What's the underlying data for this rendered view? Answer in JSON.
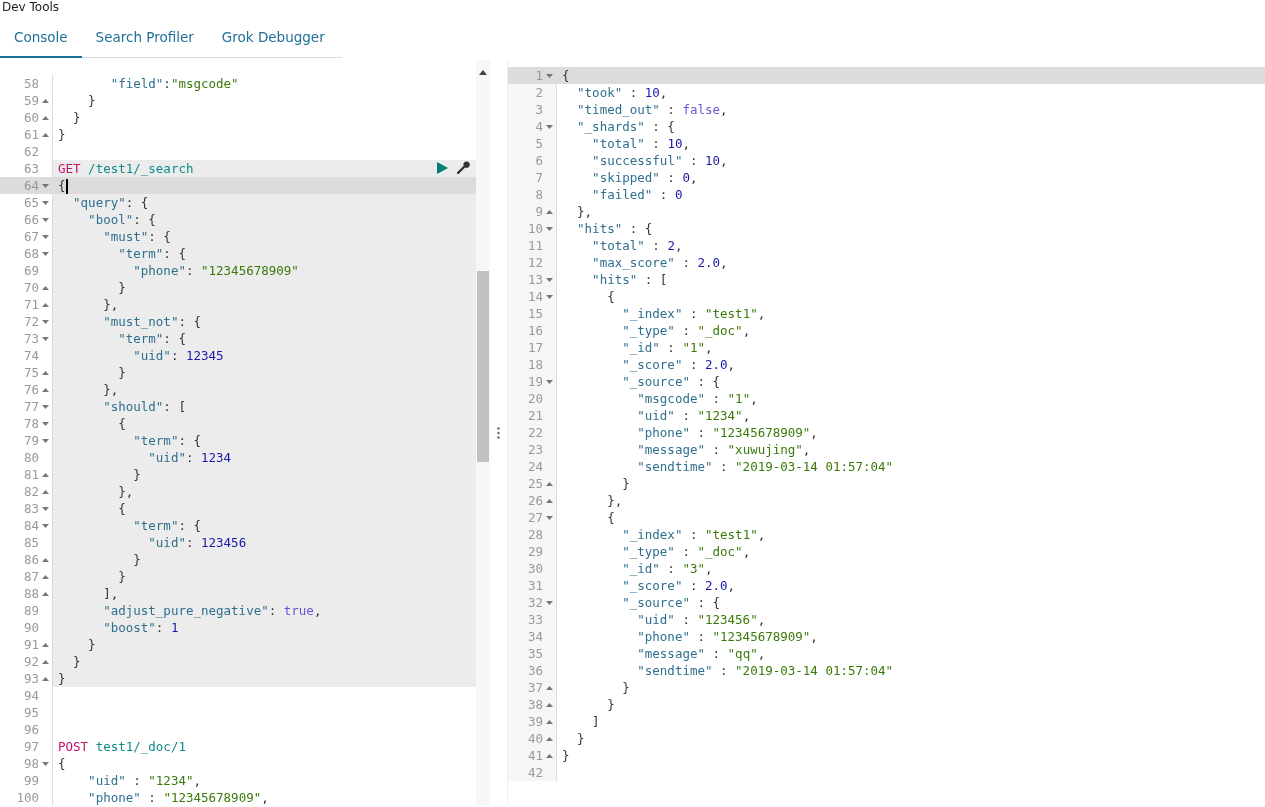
{
  "app_title": "Dev Tools",
  "tabs": [
    {
      "label": "Console",
      "selected": true
    },
    {
      "label": "Search Profiler",
      "selected": false
    },
    {
      "label": "Grok Debugger",
      "selected": false
    }
  ],
  "request_editor": {
    "lines": [
      {
        "n": "58",
        "highlighted": false,
        "active": false,
        "tokens": [
          {
            "kind": "key",
            "text": "       \"field\""
          },
          {
            "kind": "punct",
            "text": ":"
          },
          {
            "kind": "string",
            "text": "\"msgcode\""
          }
        ]
      },
      {
        "n": "59",
        "fold_start": false,
        "highlighted": false,
        "active": false,
        "tokens": [
          {
            "kind": "punct",
            "text": "    }"
          }
        ]
      },
      {
        "n": "60",
        "fold_start": false,
        "highlighted": false,
        "active": false,
        "tokens": [
          {
            "kind": "punct",
            "text": "  }"
          }
        ]
      },
      {
        "n": "61",
        "fold_start": false,
        "highlighted": false,
        "active": false,
        "tokens": [
          {
            "kind": "punct",
            "text": "}"
          }
        ]
      },
      {
        "n": "62",
        "highlighted": false,
        "active": false
      },
      {
        "n": "63",
        "highlighted": true,
        "active": false,
        "actions": true,
        "tokens": [
          {
            "kind": "method",
            "text": "GET"
          },
          {
            "kind": "url",
            "text": " /test1/_search"
          }
        ]
      },
      {
        "n": "64",
        "fold_start": true,
        "highlighted": true,
        "active": true,
        "tokens": [
          {
            "kind": "punct",
            "text": "{"
          }
        ]
      },
      {
        "n": "65",
        "fold_start": true,
        "highlighted": true,
        "active": false,
        "tokens": [
          {
            "kind": "key",
            "text": "  \"query\""
          },
          {
            "kind": "punct",
            "text": ": {"
          }
        ]
      },
      {
        "n": "66",
        "fold_start": true,
        "highlighted": true,
        "active": false,
        "tokens": [
          {
            "kind": "key",
            "text": "    \"bool\""
          },
          {
            "kind": "punct",
            "text": ": {"
          }
        ]
      },
      {
        "n": "67",
        "fold_start": true,
        "highlighted": true,
        "active": false,
        "tokens": [
          {
            "kind": "key",
            "text": "      \"must\""
          },
          {
            "kind": "punct",
            "text": ": {"
          }
        ]
      },
      {
        "n": "68",
        "fold_start": true,
        "highlighted": true,
        "active": false,
        "tokens": [
          {
            "kind": "key",
            "text": "        \"term\""
          },
          {
            "kind": "punct",
            "text": ": {"
          }
        ]
      },
      {
        "n": "69",
        "highlighted": true,
        "active": false,
        "tokens": [
          {
            "kind": "key",
            "text": "          \"phone\""
          },
          {
            "kind": "punct",
            "text": ": "
          },
          {
            "kind": "string",
            "text": "\"12345678909\""
          }
        ]
      },
      {
        "n": "70",
        "fold_start": false,
        "highlighted": true,
        "active": false,
        "tokens": [
          {
            "kind": "punct",
            "text": "        }"
          }
        ]
      },
      {
        "n": "71",
        "fold_start": false,
        "highlighted": true,
        "active": false,
        "tokens": [
          {
            "kind": "punct",
            "text": "      },"
          }
        ]
      },
      {
        "n": "72",
        "fold_start": true,
        "highlighted": true,
        "active": false,
        "tokens": [
          {
            "kind": "key",
            "text": "      \"must_not\""
          },
          {
            "kind": "punct",
            "text": ": {"
          }
        ]
      },
      {
        "n": "73",
        "fold_start": true,
        "highlighted": true,
        "active": false,
        "tokens": [
          {
            "kind": "key",
            "text": "        \"term\""
          },
          {
            "kind": "punct",
            "text": ": {"
          }
        ]
      },
      {
        "n": "74",
        "highlighted": true,
        "active": false,
        "tokens": [
          {
            "kind": "key",
            "text": "          \"uid\""
          },
          {
            "kind": "punct",
            "text": ": "
          },
          {
            "kind": "number",
            "text": "12345"
          }
        ]
      },
      {
        "n": "75",
        "fold_start": false,
        "highlighted": true,
        "active": false,
        "tokens": [
          {
            "kind": "punct",
            "text": "        }"
          }
        ]
      },
      {
        "n": "76",
        "fold_start": false,
        "highlighted": true,
        "active": false,
        "tokens": [
          {
            "kind": "punct",
            "text": "      },"
          }
        ]
      },
      {
        "n": "77",
        "fold_start": true,
        "highlighted": true,
        "active": false,
        "tokens": [
          {
            "kind": "key",
            "text": "      \"should\""
          },
          {
            "kind": "punct",
            "text": ": ["
          }
        ]
      },
      {
        "n": "78",
        "fold_start": true,
        "highlighted": true,
        "active": false,
        "tokens": [
          {
            "kind": "punct",
            "text": "        {"
          }
        ]
      },
      {
        "n": "79",
        "fold_start": true,
        "highlighted": true,
        "active": false,
        "tokens": [
          {
            "kind": "key",
            "text": "          \"term\""
          },
          {
            "kind": "punct",
            "text": ": {"
          }
        ]
      },
      {
        "n": "80",
        "highlighted": true,
        "active": false,
        "tokens": [
          {
            "kind": "key",
            "text": "            \"uid\""
          },
          {
            "kind": "punct",
            "text": ": "
          },
          {
            "kind": "number",
            "text": "1234"
          }
        ]
      },
      {
        "n": "81",
        "fold_start": false,
        "highlighted": true,
        "active": false,
        "tokens": [
          {
            "kind": "punct",
            "text": "          }"
          }
        ]
      },
      {
        "n": "82",
        "fold_start": false,
        "highlighted": true,
        "active": false,
        "tokens": [
          {
            "kind": "punct",
            "text": "        },"
          }
        ]
      },
      {
        "n": "83",
        "fold_start": true,
        "highlighted": true,
        "active": false,
        "tokens": [
          {
            "kind": "punct",
            "text": "        {"
          }
        ]
      },
      {
        "n": "84",
        "fold_start": true,
        "highlighted": true,
        "active": false,
        "tokens": [
          {
            "kind": "key",
            "text": "          \"term\""
          },
          {
            "kind": "punct",
            "text": ": {"
          }
        ]
      },
      {
        "n": "85",
        "highlighted": true,
        "active": false,
        "tokens": [
          {
            "kind": "key",
            "text": "            \"uid\""
          },
          {
            "kind": "punct",
            "text": ": "
          },
          {
            "kind": "number",
            "text": "123456"
          }
        ]
      },
      {
        "n": "86",
        "fold_start": false,
        "highlighted": true,
        "active": false,
        "tokens": [
          {
            "kind": "punct",
            "text": "          }"
          }
        ]
      },
      {
        "n": "87",
        "fold_start": false,
        "highlighted": true,
        "active": false,
        "tokens": [
          {
            "kind": "punct",
            "text": "        }"
          }
        ]
      },
      {
        "n": "88",
        "fold_start": false,
        "highlighted": true,
        "active": false,
        "tokens": [
          {
            "kind": "punct",
            "text": "      ],"
          }
        ]
      },
      {
        "n": "89",
        "highlighted": true,
        "active": false,
        "tokens": [
          {
            "kind": "key",
            "text": "      \"adjust_pure_negative\""
          },
          {
            "kind": "punct",
            "text": ": "
          },
          {
            "kind": "bool",
            "text": "true"
          },
          {
            "kind": "punct",
            "text": ","
          }
        ]
      },
      {
        "n": "90",
        "highlighted": true,
        "active": false,
        "tokens": [
          {
            "kind": "key",
            "text": "      \"boost\""
          },
          {
            "kind": "punct",
            "text": ": "
          },
          {
            "kind": "number",
            "text": "1"
          }
        ]
      },
      {
        "n": "91",
        "fold_start": false,
        "highlighted": true,
        "active": false,
        "tokens": [
          {
            "kind": "punct",
            "text": "    }"
          }
        ]
      },
      {
        "n": "92",
        "fold_start": false,
        "highlighted": true,
        "active": false,
        "tokens": [
          {
            "kind": "punct",
            "text": "  }"
          }
        ]
      },
      {
        "n": "93",
        "fold_start": false,
        "highlighted": true,
        "active": false,
        "tokens": [
          {
            "kind": "punct",
            "text": "}"
          }
        ]
      },
      {
        "n": "94",
        "highlighted": false,
        "active": false
      },
      {
        "n": "95",
        "highlighted": false,
        "active": false
      },
      {
        "n": "96",
        "highlighted": false,
        "active": false
      },
      {
        "n": "97",
        "highlighted": false,
        "active": false,
        "tokens": [
          {
            "kind": "method",
            "text": "POST"
          },
          {
            "kind": "url",
            "text": " test1/_doc/1"
          }
        ]
      },
      {
        "n": "98",
        "fold_start": true,
        "highlighted": false,
        "active": false,
        "tokens": [
          {
            "kind": "punct",
            "text": "{"
          }
        ]
      },
      {
        "n": "99",
        "highlighted": false,
        "active": false,
        "tokens": [
          {
            "kind": "key",
            "text": "    \"uid\""
          },
          {
            "kind": "punct",
            "text": " : "
          },
          {
            "kind": "string",
            "text": "\"1234\""
          },
          {
            "kind": "punct",
            "text": ","
          }
        ]
      },
      {
        "n": "100",
        "highlighted": false,
        "active": false,
        "tokens": [
          {
            "kind": "key",
            "text": "    \"phone\""
          },
          {
            "kind": "punct",
            "text": " : "
          },
          {
            "kind": "string",
            "text": "\"12345678909\""
          },
          {
            "kind": "punct",
            "text": ","
          }
        ]
      }
    ]
  },
  "response_viewer": {
    "lines": [
      {
        "n": "1",
        "fold_start": true,
        "active": true,
        "tokens": [
          {
            "kind": "punct",
            "text": "{"
          }
        ]
      },
      {
        "n": "2",
        "active": false,
        "tokens": [
          {
            "kind": "key",
            "text": "  \"took\""
          },
          {
            "kind": "punct",
            "text": " : "
          },
          {
            "kind": "number",
            "text": "10"
          },
          {
            "kind": "punct",
            "text": ","
          }
        ]
      },
      {
        "n": "3",
        "active": false,
        "tokens": [
          {
            "kind": "key",
            "text": "  \"timed_out\""
          },
          {
            "kind": "punct",
            "text": " : "
          },
          {
            "kind": "bool",
            "text": "false"
          },
          {
            "kind": "punct",
            "text": ","
          }
        ]
      },
      {
        "n": "4",
        "fold_start": true,
        "active": false,
        "tokens": [
          {
            "kind": "key",
            "text": "  \"_shards\""
          },
          {
            "kind": "punct",
            "text": " : {"
          }
        ]
      },
      {
        "n": "5",
        "active": false,
        "tokens": [
          {
            "kind": "key",
            "text": "    \"total\""
          },
          {
            "kind": "punct",
            "text": " : "
          },
          {
            "kind": "number",
            "text": "10"
          },
          {
            "kind": "punct",
            "text": ","
          }
        ]
      },
      {
        "n": "6",
        "active": false,
        "tokens": [
          {
            "kind": "key",
            "text": "    \"successful\""
          },
          {
            "kind": "punct",
            "text": " : "
          },
          {
            "kind": "number",
            "text": "10"
          },
          {
            "kind": "punct",
            "text": ","
          }
        ]
      },
      {
        "n": "7",
        "active": false,
        "tokens": [
          {
            "kind": "key",
            "text": "    \"skipped\""
          },
          {
            "kind": "punct",
            "text": " : "
          },
          {
            "kind": "number",
            "text": "0"
          },
          {
            "kind": "punct",
            "text": ","
          }
        ]
      },
      {
        "n": "8",
        "active": false,
        "tokens": [
          {
            "kind": "key",
            "text": "    \"failed\""
          },
          {
            "kind": "punct",
            "text": " : "
          },
          {
            "kind": "number",
            "text": "0"
          }
        ]
      },
      {
        "n": "9",
        "fold_start": false,
        "active": false,
        "tokens": [
          {
            "kind": "punct",
            "text": "  },"
          }
        ]
      },
      {
        "n": "10",
        "fold_start": true,
        "active": false,
        "tokens": [
          {
            "kind": "key",
            "text": "  \"hits\""
          },
          {
            "kind": "punct",
            "text": " : {"
          }
        ]
      },
      {
        "n": "11",
        "active": false,
        "tokens": [
          {
            "kind": "key",
            "text": "    \"total\""
          },
          {
            "kind": "punct",
            "text": " : "
          },
          {
            "kind": "number",
            "text": "2"
          },
          {
            "kind": "punct",
            "text": ","
          }
        ]
      },
      {
        "n": "12",
        "active": false,
        "tokens": [
          {
            "kind": "key",
            "text": "    \"max_score\""
          },
          {
            "kind": "punct",
            "text": " : "
          },
          {
            "kind": "number",
            "text": "2.0"
          },
          {
            "kind": "punct",
            "text": ","
          }
        ]
      },
      {
        "n": "13",
        "fold_start": true,
        "active": false,
        "tokens": [
          {
            "kind": "key",
            "text": "    \"hits\""
          },
          {
            "kind": "punct",
            "text": " : ["
          }
        ]
      },
      {
        "n": "14",
        "fold_start": true,
        "active": false,
        "tokens": [
          {
            "kind": "punct",
            "text": "      {"
          }
        ]
      },
      {
        "n": "15",
        "active": false,
        "tokens": [
          {
            "kind": "key",
            "text": "        \"_index\""
          },
          {
            "kind": "punct",
            "text": " : "
          },
          {
            "kind": "string",
            "text": "\"test1\""
          },
          {
            "kind": "punct",
            "text": ","
          }
        ]
      },
      {
        "n": "16",
        "active": false,
        "tokens": [
          {
            "kind": "key",
            "text": "        \"_type\""
          },
          {
            "kind": "punct",
            "text": " : "
          },
          {
            "kind": "string",
            "text": "\"_doc\""
          },
          {
            "kind": "punct",
            "text": ","
          }
        ]
      },
      {
        "n": "17",
        "active": false,
        "tokens": [
          {
            "kind": "key",
            "text": "        \"_id\""
          },
          {
            "kind": "punct",
            "text": " : "
          },
          {
            "kind": "string",
            "text": "\"1\""
          },
          {
            "kind": "punct",
            "text": ","
          }
        ]
      },
      {
        "n": "18",
        "active": false,
        "tokens": [
          {
            "kind": "key",
            "text": "        \"_score\""
          },
          {
            "kind": "punct",
            "text": " : "
          },
          {
            "kind": "number",
            "text": "2.0"
          },
          {
            "kind": "punct",
            "text": ","
          }
        ]
      },
      {
        "n": "19",
        "fold_start": true,
        "active": false,
        "tokens": [
          {
            "kind": "key",
            "text": "        \"_source\""
          },
          {
            "kind": "punct",
            "text": " : {"
          }
        ]
      },
      {
        "n": "20",
        "active": false,
        "tokens": [
          {
            "kind": "key",
            "text": "          \"msgcode\""
          },
          {
            "kind": "punct",
            "text": " : "
          },
          {
            "kind": "string",
            "text": "\"1\""
          },
          {
            "kind": "punct",
            "text": ","
          }
        ]
      },
      {
        "n": "21",
        "active": false,
        "tokens": [
          {
            "kind": "key",
            "text": "          \"uid\""
          },
          {
            "kind": "punct",
            "text": " : "
          },
          {
            "kind": "string",
            "text": "\"1234\""
          },
          {
            "kind": "punct",
            "text": ","
          }
        ]
      },
      {
        "n": "22",
        "active": false,
        "tokens": [
          {
            "kind": "key",
            "text": "          \"phone\""
          },
          {
            "kind": "punct",
            "text": " : "
          },
          {
            "kind": "string",
            "text": "\"12345678909\""
          },
          {
            "kind": "punct",
            "text": ","
          }
        ]
      },
      {
        "n": "23",
        "active": false,
        "tokens": [
          {
            "kind": "key",
            "text": "          \"message\""
          },
          {
            "kind": "punct",
            "text": " : "
          },
          {
            "kind": "string",
            "text": "\"xuwujing\""
          },
          {
            "kind": "punct",
            "text": ","
          }
        ]
      },
      {
        "n": "24",
        "active": false,
        "tokens": [
          {
            "kind": "key",
            "text": "          \"sendtime\""
          },
          {
            "kind": "punct",
            "text": " : "
          },
          {
            "kind": "string",
            "text": "\"2019-03-14 01:57:04\""
          }
        ]
      },
      {
        "n": "25",
        "fold_start": false,
        "active": false,
        "tokens": [
          {
            "kind": "punct",
            "text": "        }"
          }
        ]
      },
      {
        "n": "26",
        "fold_start": false,
        "active": false,
        "tokens": [
          {
            "kind": "punct",
            "text": "      },"
          }
        ]
      },
      {
        "n": "27",
        "fold_start": true,
        "active": false,
        "tokens": [
          {
            "kind": "punct",
            "text": "      {"
          }
        ]
      },
      {
        "n": "28",
        "active": false,
        "tokens": [
          {
            "kind": "key",
            "text": "        \"_index\""
          },
          {
            "kind": "punct",
            "text": " : "
          },
          {
            "kind": "string",
            "text": "\"test1\""
          },
          {
            "kind": "punct",
            "text": ","
          }
        ]
      },
      {
        "n": "29",
        "active": false,
        "tokens": [
          {
            "kind": "key",
            "text": "        \"_type\""
          },
          {
            "kind": "punct",
            "text": " : "
          },
          {
            "kind": "string",
            "text": "\"_doc\""
          },
          {
            "kind": "punct",
            "text": ","
          }
        ]
      },
      {
        "n": "30",
        "active": false,
        "tokens": [
          {
            "kind": "key",
            "text": "        \"_id\""
          },
          {
            "kind": "punct",
            "text": " : "
          },
          {
            "kind": "string",
            "text": "\"3\""
          },
          {
            "kind": "punct",
            "text": ","
          }
        ]
      },
      {
        "n": "31",
        "active": false,
        "tokens": [
          {
            "kind": "key",
            "text": "        \"_score\""
          },
          {
            "kind": "punct",
            "text": " : "
          },
          {
            "kind": "number",
            "text": "2.0"
          },
          {
            "kind": "punct",
            "text": ","
          }
        ]
      },
      {
        "n": "32",
        "fold_start": true,
        "active": false,
        "tokens": [
          {
            "kind": "key",
            "text": "        \"_source\""
          },
          {
            "kind": "punct",
            "text": " : {"
          }
        ]
      },
      {
        "n": "33",
        "active": false,
        "tokens": [
          {
            "kind": "key",
            "text": "          \"uid\""
          },
          {
            "kind": "punct",
            "text": " : "
          },
          {
            "kind": "string",
            "text": "\"123456\""
          },
          {
            "kind": "punct",
            "text": ","
          }
        ]
      },
      {
        "n": "34",
        "active": false,
        "tokens": [
          {
            "kind": "key",
            "text": "          \"phone\""
          },
          {
            "kind": "punct",
            "text": " : "
          },
          {
            "kind": "string",
            "text": "\"12345678909\""
          },
          {
            "kind": "punct",
            "text": ","
          }
        ]
      },
      {
        "n": "35",
        "active": false,
        "tokens": [
          {
            "kind": "key",
            "text": "          \"message\""
          },
          {
            "kind": "punct",
            "text": " : "
          },
          {
            "kind": "string",
            "text": "\"qq\""
          },
          {
            "kind": "punct",
            "text": ","
          }
        ]
      },
      {
        "n": "36",
        "active": false,
        "tokens": [
          {
            "kind": "key",
            "text": "          \"sendtime\""
          },
          {
            "kind": "punct",
            "text": " : "
          },
          {
            "kind": "string",
            "text": "\"2019-03-14 01:57:04\""
          }
        ]
      },
      {
        "n": "37",
        "fold_start": false,
        "active": false,
        "tokens": [
          {
            "kind": "punct",
            "text": "        }"
          }
        ]
      },
      {
        "n": "38",
        "fold_start": false,
        "active": false,
        "tokens": [
          {
            "kind": "punct",
            "text": "      }"
          }
        ]
      },
      {
        "n": "39",
        "fold_start": false,
        "active": false,
        "tokens": [
          {
            "kind": "punct",
            "text": "    ]"
          }
        ]
      },
      {
        "n": "40",
        "fold_start": false,
        "active": false,
        "tokens": [
          {
            "kind": "punct",
            "text": "  }"
          }
        ]
      },
      {
        "n": "41",
        "fold_start": false,
        "active": false,
        "tokens": [
          {
            "kind": "punct",
            "text": "}"
          }
        ]
      },
      {
        "n": "42",
        "active": false
      }
    ]
  }
}
